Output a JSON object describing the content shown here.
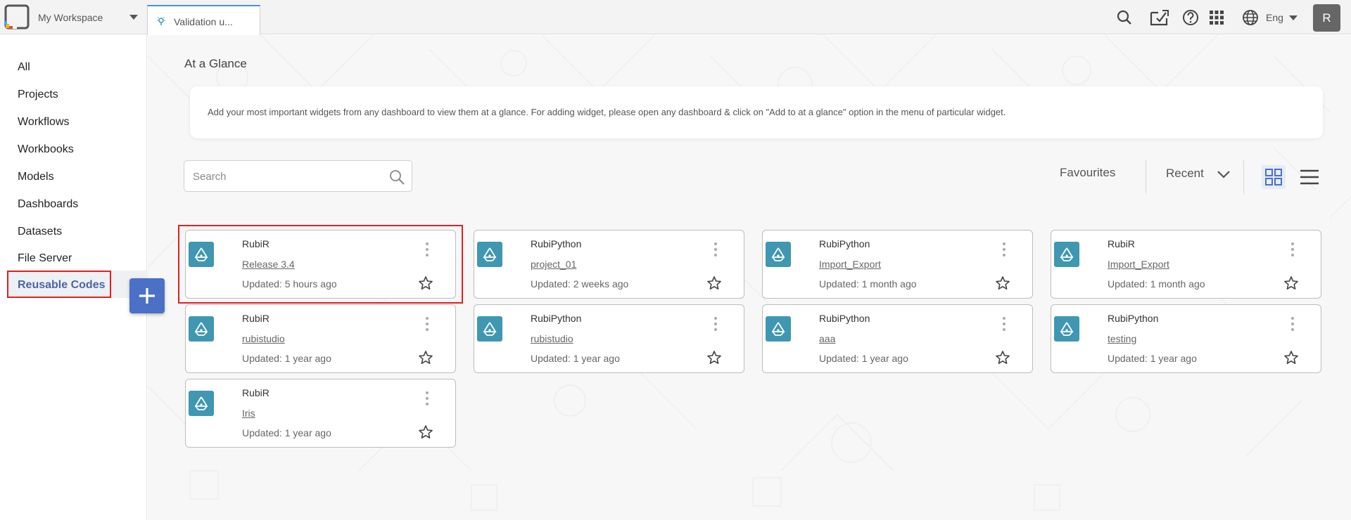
{
  "topbar": {
    "workspace_label": "My Workspace",
    "tab_label": "Validation u...",
    "language_label": "Eng",
    "avatar_initial": "R",
    "icons": [
      "search-icon",
      "download-icon",
      "help-icon",
      "apps-grid-icon",
      "globe-icon"
    ]
  },
  "sidebar": {
    "items": [
      {
        "label": "All"
      },
      {
        "label": "Projects"
      },
      {
        "label": "Workflows"
      },
      {
        "label": "Workbooks"
      },
      {
        "label": "Models"
      },
      {
        "label": "Dashboards"
      },
      {
        "label": "Datasets"
      },
      {
        "label": "File Server"
      },
      {
        "label": "Reusable Codes",
        "active": true
      }
    ],
    "add_button_icon": "plus-icon"
  },
  "main": {
    "glance_title": "At a Glance",
    "glance_message": "Add your most important widgets from any dashboard to view them at a glance. For adding widget, please open any dashboard & click on \"Add to at a glance\" option in the menu of particular widget.",
    "search_placeholder": "Search",
    "favourites_label": "Favourites",
    "recent_label": "Recent"
  },
  "cards": [
    {
      "title": "RubiR",
      "name": "Release 3.4",
      "updated": "Updated: 5 hours ago"
    },
    {
      "title": "RubiPython",
      "name": "project_01",
      "updated": "Updated: 2 weeks ago"
    },
    {
      "title": "RubiPython",
      "name": "Import_Export",
      "updated": "Updated: 1 month ago"
    },
    {
      "title": "RubiR",
      "name": "Import_Export",
      "updated": "Updated: 1 month ago"
    },
    {
      "title": "RubiR",
      "name": "rubistudio",
      "updated": "Updated: 1 year ago"
    },
    {
      "title": "RubiPython",
      "name": "rubistudio",
      "updated": "Updated: 1 year ago"
    },
    {
      "title": "RubiPython",
      "name": "aaa",
      "updated": "Updated: 1 year ago"
    },
    {
      "title": "RubiPython",
      "name": "testing",
      "updated": "Updated: 1 year ago"
    },
    {
      "title": "RubiR",
      "name": "Iris",
      "updated": "Updated: 1 year ago"
    }
  ],
  "colors": {
    "accent": "#4b70c5",
    "active_text": "#4866a8",
    "card_icon": "#3f97b1",
    "highlight": "#e02020"
  }
}
